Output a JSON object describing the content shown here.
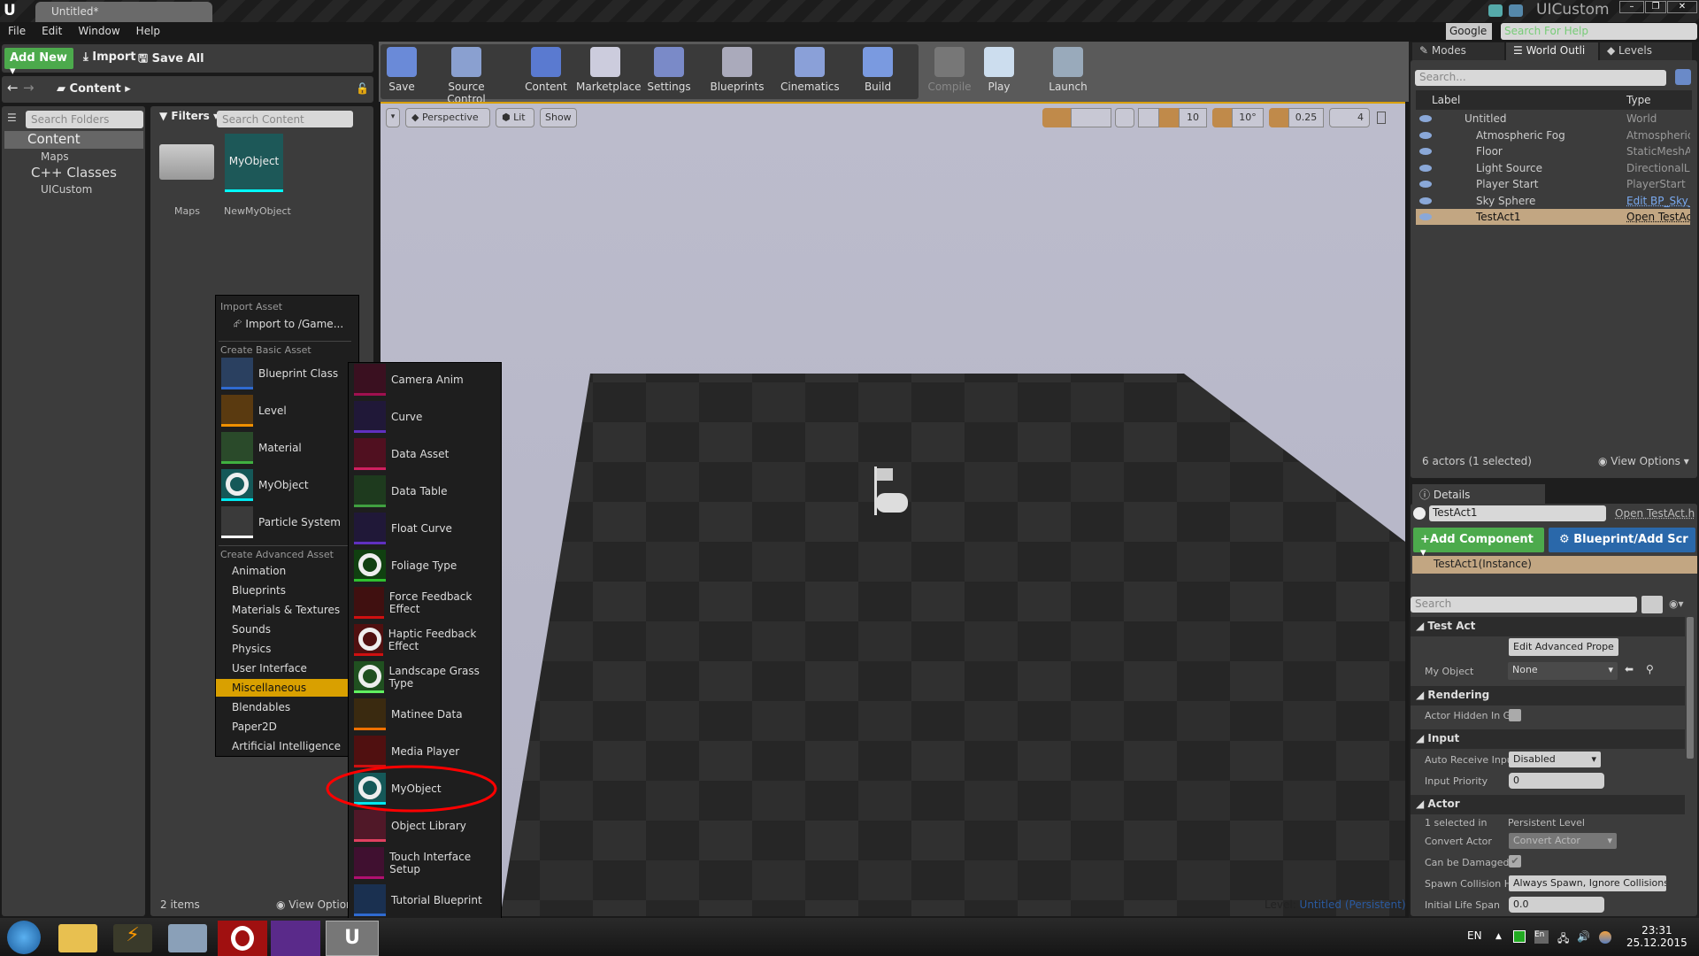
{
  "window": {
    "tab": "Untitled*",
    "project": "UICustom",
    "search_engine": "Google",
    "help_placeholder": "Search For Help"
  },
  "menubar": [
    "File",
    "Edit",
    "Window",
    "Help"
  ],
  "content_browser": {
    "add_new": "Add New",
    "import": "Import",
    "save_all": "Save All",
    "path": "Content",
    "folder_search": "Search Folders",
    "filters": "Filters",
    "content_search": "Search Content",
    "tree": [
      {
        "label": "Content"
      },
      {
        "label": "Maps"
      },
      {
        "label": "C++ Classes"
      },
      {
        "label": "UICustom"
      }
    ],
    "assets": [
      {
        "label": "Maps",
        "thumb": ""
      },
      {
        "label": "NewMyObject",
        "thumb": "MyObject"
      }
    ],
    "count": "2 items",
    "view_options": "View Options"
  },
  "toolbar": [
    "Save",
    "Source Control",
    "Content",
    "Marketplace",
    "Settings",
    "Blueprints",
    "Cinematics",
    "Build",
    "Compile",
    "Play",
    "Launch"
  ],
  "viewport": {
    "perspective": "Perspective",
    "lit": "Lit",
    "show": "Show",
    "grid_snap": "10",
    "rot_snap": "10°",
    "scale_snap": "0.25",
    "cam_speed": "4",
    "level_label": "Level:",
    "level_name": "Untitled (Persistent)"
  },
  "add_menu": {
    "import_header": "Import Asset",
    "import_item": "Import to /Game...",
    "basic_header": "Create Basic Asset",
    "basic": [
      {
        "label": "Blueprint Class",
        "color": "#2f6ad0",
        "bg": "#2a4060"
      },
      {
        "label": "Level",
        "color": "#f09000",
        "bg": "#5a3a10"
      },
      {
        "label": "Material",
        "color": "#40b040",
        "bg": "#2a4a2a"
      },
      {
        "label": "MyObject",
        "color": "#00e8f0",
        "bg": "#155858"
      },
      {
        "label": "Particle System",
        "color": "#ffffff",
        "bg": "#3a3a3a"
      }
    ],
    "advanced_header": "Create Advanced Asset",
    "advanced": [
      "Animation",
      "Blueprints",
      "Materials & Textures",
      "Sounds",
      "Physics",
      "User Interface",
      "Miscellaneous",
      "Blendables",
      "Paper2D",
      "Artificial Intelligence"
    ],
    "highlighted": "Miscellaneous"
  },
  "misc_menu": [
    {
      "label": "Camera Anim",
      "color": "#a01050",
      "bg": "#3a1020"
    },
    {
      "label": "Curve",
      "color": "#6030c0",
      "bg": "#201838"
    },
    {
      "label": "Data Asset",
      "color": "#d02060",
      "bg": "#501020"
    },
    {
      "label": "Data Table",
      "color": "#40a040",
      "bg": "#1e3a1e"
    },
    {
      "label": "Float Curve",
      "color": "#6030c0",
      "bg": "#201838"
    },
    {
      "label": "Foliage Type",
      "color": "#30c030",
      "bg": "#104010"
    },
    {
      "label": "Force Feedback Effect",
      "color": "#d01010",
      "bg": "#401010"
    },
    {
      "label": "Haptic Feedback Effect",
      "color": "#d01010",
      "bg": "#501010"
    },
    {
      "label": "Landscape Grass Type",
      "color": "#60f060",
      "bg": "#205020"
    },
    {
      "label": "Matinee Data",
      "color": "#f07000",
      "bg": "#3a2a10"
    },
    {
      "label": "Media Player",
      "color": "#d01010",
      "bg": "#501010"
    },
    {
      "label": "MyObject",
      "color": "#00e8f0",
      "bg": "#155858"
    },
    {
      "label": "Object Library",
      "color": "#e04060",
      "bg": "#501828"
    },
    {
      "label": "Touch Interface Setup",
      "color": "#b01070",
      "bg": "#401030"
    },
    {
      "label": "Tutorial Blueprint",
      "color": "#2f6ad0",
      "bg": "#1a3050"
    }
  ],
  "outliner": {
    "tabs": [
      "Modes",
      "World Outli",
      "Levels"
    ],
    "search": "Search...",
    "col_label": "Label",
    "col_type": "Type",
    "rows": [
      {
        "label": "Untitled",
        "type": "World"
      },
      {
        "label": "Atmospheric Fog",
        "type": "AtmosphericFog"
      },
      {
        "label": "Floor",
        "type": "StaticMeshActor"
      },
      {
        "label": "Light Source",
        "type": "DirectionalLight"
      },
      {
        "label": "Player Start",
        "type": "PlayerStart"
      },
      {
        "label": "Sky Sphere",
        "type": "Edit BP_Sky_S"
      },
      {
        "label": "TestAct1",
        "type": "Open TestAct.h"
      }
    ],
    "status": "6 actors (1 selected)",
    "view_options": "View Options"
  },
  "details": {
    "tab": "Details",
    "name": "TestAct1",
    "open_link": "Open TestAct.h",
    "add_component": "Add Component",
    "blueprint": "Blueprint/Add Scr",
    "instance": "TestAct1(Instance)",
    "search": "Search",
    "sections": {
      "test_act": "Test Act",
      "rendering": "Rendering",
      "input": "Input",
      "actor": "Actor"
    },
    "edit_advanced": "Edit Advanced Prope",
    "my_object_label": "My Object",
    "my_object_value": "None",
    "actor_hidden": "Actor Hidden In Ga",
    "actor_hidden_checked": false,
    "auto_receive": "Auto Receive Inpu",
    "auto_receive_value": "Disabled",
    "input_priority": "Input Priority",
    "input_priority_value": "0",
    "selected_in": "1 selected in",
    "selected_level": "Persistent Level",
    "convert_actor": "Convert Actor",
    "convert_actor_value": "Convert Actor",
    "can_be_damaged": "Can be Damaged",
    "can_be_damaged_checked": true,
    "spawn_collision": "Spawn Collision H",
    "spawn_collision_value": "Always Spawn, Ignore Collisions",
    "initial_life": "Initial Life Span",
    "initial_life_value": "0.0"
  },
  "taskbar": {
    "lang": "EN",
    "time": "23:31",
    "date": "25.12.2015",
    "ime": "En"
  }
}
